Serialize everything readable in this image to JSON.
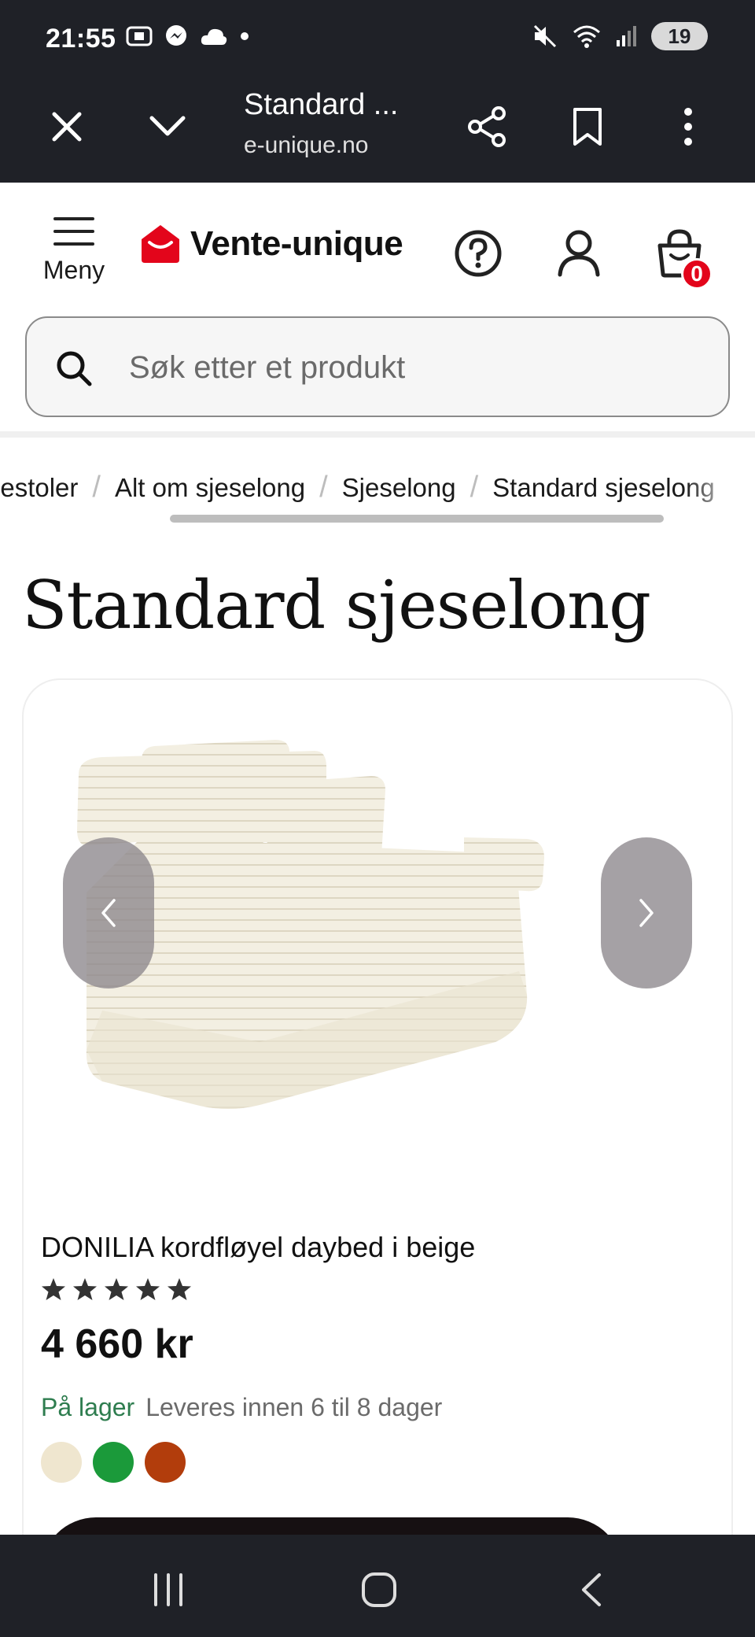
{
  "status_bar": {
    "time": "21:55",
    "battery": "19"
  },
  "browser": {
    "title": "Standard ...",
    "url": "e-unique.no"
  },
  "header": {
    "menu_label": "Meny",
    "logo_text": "Vente-unique",
    "cart_count": "0",
    "brand_color": "#e3051b"
  },
  "search": {
    "placeholder": "Søk etter et produkt"
  },
  "breadcrumb": {
    "items": [
      "nestoler",
      "Alt om sjeselong",
      "Sjeselong",
      "Standard sjeselong"
    ],
    "separator": "/"
  },
  "page": {
    "title": "Standard sjeselong"
  },
  "product": {
    "name": "DONILIA kordfløyel daybed i beige",
    "rating_stars": 5,
    "price": "4 660 kr",
    "stock_status": "På lager",
    "delivery": "Leveres innen 6 til 8 dager",
    "swatches": [
      "#efe6cf",
      "#1b9a3a",
      "#b23d0c"
    ]
  }
}
